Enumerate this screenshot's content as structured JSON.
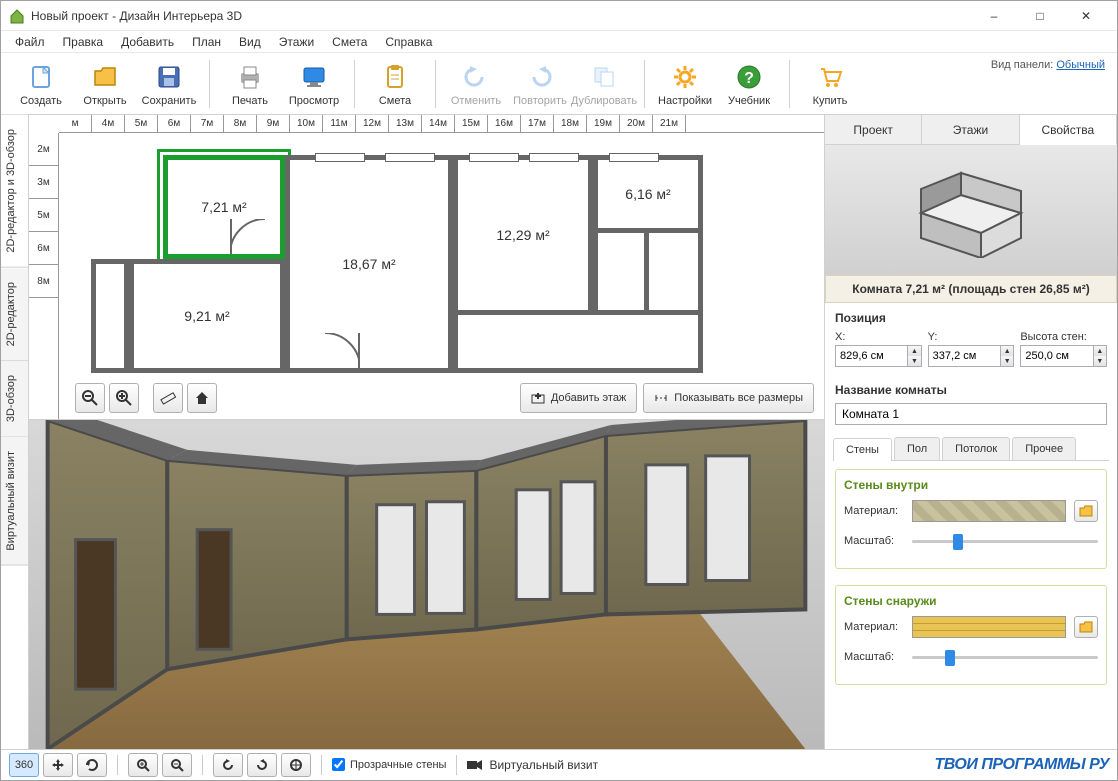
{
  "window": {
    "title": "Новый проект - Дизайн Интерьера 3D"
  },
  "menu": [
    "Файл",
    "Правка",
    "Добавить",
    "План",
    "Вид",
    "Этажи",
    "Смета",
    "Справка"
  ],
  "toolbar": [
    {
      "id": "create",
      "label": "Создать",
      "icon": "file"
    },
    {
      "id": "open",
      "label": "Открыть",
      "icon": "folder"
    },
    {
      "id": "save",
      "label": "Сохранить",
      "icon": "disk"
    },
    {
      "sep": true
    },
    {
      "id": "print",
      "label": "Печать",
      "icon": "printer"
    },
    {
      "id": "preview",
      "label": "Просмотр",
      "icon": "monitor"
    },
    {
      "sep": true
    },
    {
      "id": "estimate",
      "label": "Смета",
      "icon": "clipboard"
    },
    {
      "sep": true
    },
    {
      "id": "undo",
      "label": "Отменить",
      "icon": "undo",
      "disabled": true
    },
    {
      "id": "redo",
      "label": "Повторить",
      "icon": "redo",
      "disabled": true
    },
    {
      "id": "dup",
      "label": "Дублировать",
      "icon": "dup",
      "disabled": true
    },
    {
      "sep": true
    },
    {
      "id": "settings",
      "label": "Настройки",
      "icon": "gear"
    },
    {
      "id": "help",
      "label": "Учебник",
      "icon": "help"
    },
    {
      "sep": true
    },
    {
      "id": "buy",
      "label": "Купить",
      "icon": "cart"
    }
  ],
  "panel_mode": {
    "label": "Вид панели:",
    "value": "Обычный"
  },
  "side_tabs": [
    "2D-редактор и 3D-обзор",
    "2D-редактор",
    "3D-обзор",
    "Виртуальный визит"
  ],
  "side_active": 0,
  "ruler_h": [
    "м",
    "4м",
    "5м",
    "6м",
    "7м",
    "8м",
    "9м",
    "10м",
    "11м",
    "12м",
    "13м",
    "14м",
    "15м",
    "16м",
    "17м",
    "18м",
    "19м",
    "20м",
    "21м"
  ],
  "ruler_v": [
    "2м",
    "3м",
    "5м",
    "6м",
    "8м"
  ],
  "rooms": [
    {
      "label": "7,21 м²",
      "sel": true
    },
    {
      "label": "18,67 м²"
    },
    {
      "label": "12,29 м²"
    },
    {
      "label": "6,16 м²"
    },
    {
      "label": "9,21 м²"
    }
  ],
  "floor_buttons": {
    "add": "Добавить этаж",
    "show": "Показывать все размеры"
  },
  "right_tabs": [
    "Проект",
    "Этажи",
    "Свойства"
  ],
  "right_active": 2,
  "room_info": "Комната 7,21 м²  (площадь стен 26,85 м²)",
  "position": {
    "heading": "Позиция",
    "x_label": "X:",
    "x": "829,6 см",
    "y_label": "Y:",
    "y": "337,2 см",
    "h_label": "Высота стен:",
    "h": "250,0 см"
  },
  "room_name": {
    "heading": "Название комнаты",
    "value": "Комната 1"
  },
  "subtabs": [
    "Стены",
    "Пол",
    "Потолок",
    "Прочее"
  ],
  "subtab_active": 0,
  "wall_inside": {
    "title": "Стены внутри",
    "material_label": "Материал:",
    "scale_label": "Масштаб:",
    "slider": 22
  },
  "wall_outside": {
    "title": "Стены снаружи",
    "material_label": "Материал:",
    "scale_label": "Масштаб:",
    "slider": 18
  },
  "bottom": {
    "transparent": "Прозрачные стены",
    "virtual": "Виртуальный визит"
  },
  "watermark": "ТВОИ ПРОГРАММЫ РУ"
}
